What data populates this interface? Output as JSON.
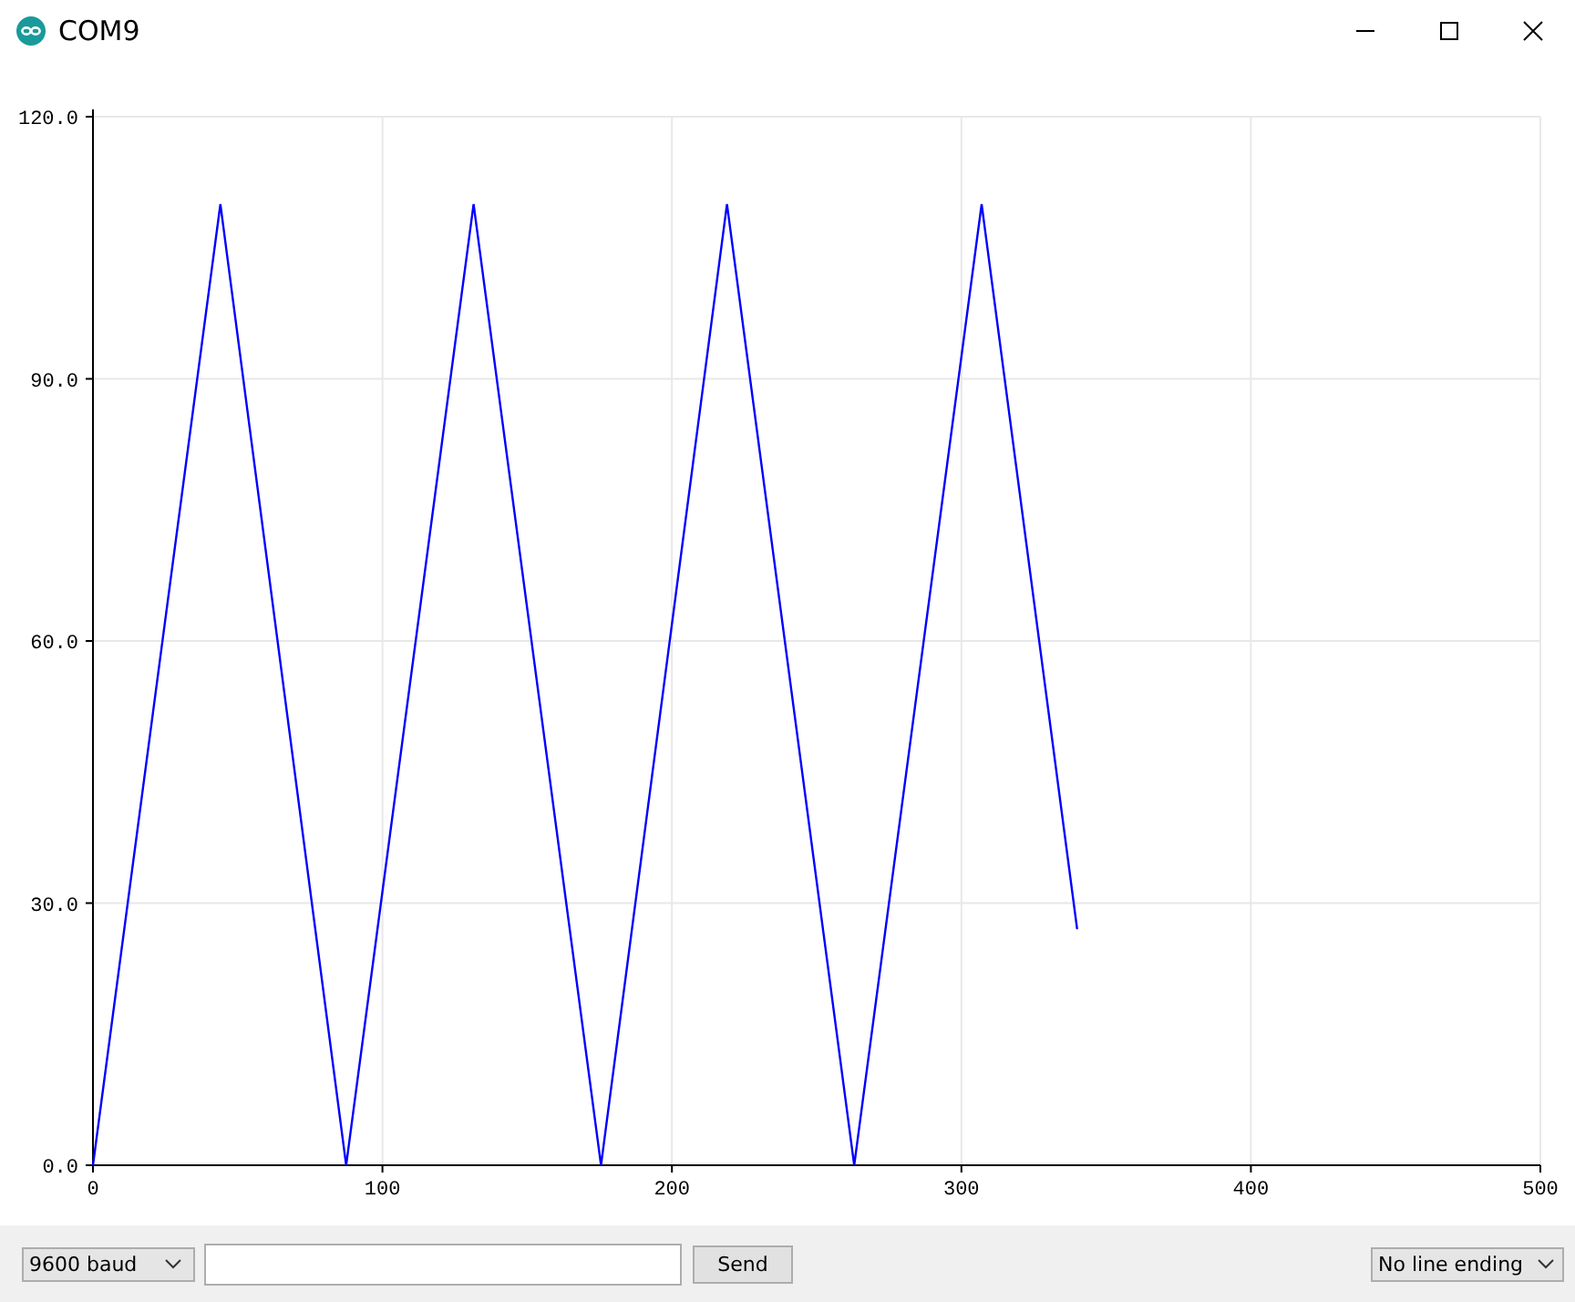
{
  "window": {
    "title": "COM9"
  },
  "plotter": {
    "chart_data": {
      "type": "line",
      "x": [
        0,
        44,
        87.5,
        131.5,
        175.5,
        219,
        263,
        307,
        340
      ],
      "series": [
        {
          "color": "#0000ff",
          "values": [
            0,
            110,
            0,
            110,
            0,
            110,
            0,
            110,
            27
          ]
        }
      ],
      "grid": true,
      "xlim": [
        0,
        500
      ],
      "ylim": [
        0,
        120
      ],
      "xticks": [
        0,
        100,
        200,
        300,
        400,
        500
      ],
      "yticks": [
        {
          "value": 0,
          "label": "0.0"
        },
        {
          "value": 30,
          "label": "30.0"
        },
        {
          "value": 60,
          "label": "60.0"
        },
        {
          "value": 90,
          "label": "90.0"
        },
        {
          "value": 120,
          "label": "120.0"
        }
      ]
    }
  },
  "bottom_bar": {
    "baud": {
      "value": "9600 baud"
    },
    "send_button": "Send",
    "line_ending": {
      "value": "No line ending"
    }
  }
}
